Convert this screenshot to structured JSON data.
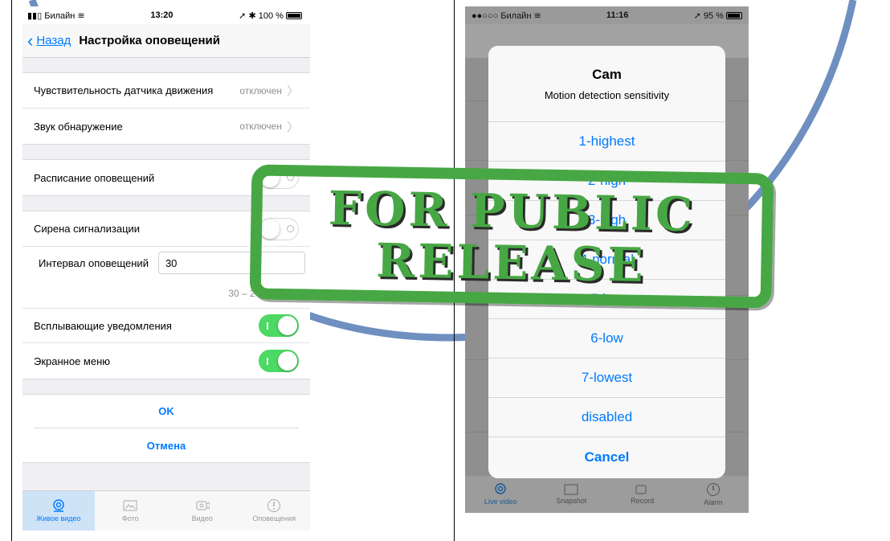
{
  "left": {
    "status": {
      "carrier": "Билайн",
      "time": "13:20",
      "battery": "100 %"
    },
    "nav": {
      "back": "Назад",
      "title": "Настройка оповещений"
    },
    "rows": [
      {
        "label": "Чувствительность датчика движения",
        "value": "отключен"
      },
      {
        "label": "Звук обнаружение",
        "value": "отключен"
      }
    ],
    "schedule_label": "Расписание оповещений",
    "siren_label": "Сирена сигнализации",
    "interval": {
      "label": "Интервал оповещений",
      "value": "30"
    },
    "range_text": "30 – 240 секунд",
    "popup_label": "Всплывающие  уведомления",
    "osd_label": "Экранное меню",
    "buttons": {
      "ok": "OK",
      "cancel": "Отмена"
    },
    "tabs": [
      "Живое видео",
      "Фото",
      "Видео",
      "Оповещения"
    ]
  },
  "right": {
    "status": {
      "carrier": "Билайн",
      "time": "11:16",
      "battery": "95 %"
    },
    "alert": {
      "title": "Cam",
      "message": "Motion detection sensitivity",
      "options": [
        "1-highest",
        "2-high",
        "3-high",
        "4-normal",
        "5-low",
        "6-low",
        "7-lowest",
        "disabled"
      ],
      "cancel": "Cancel"
    },
    "tabs": [
      "Live video",
      "Snapshot",
      "Record",
      "Alarm"
    ]
  },
  "stamp": {
    "line1": "FOR PUBLIC",
    "line2": "RELEASE"
  },
  "colors": {
    "ios_blue": "#007aff",
    "toggle_on": "#4cd964",
    "stamp_green": "#47a744"
  }
}
